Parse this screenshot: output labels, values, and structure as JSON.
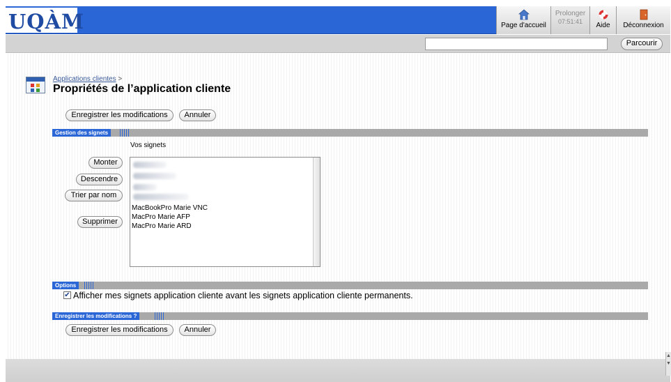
{
  "header": {
    "logo": "UQÀM",
    "home_label": "Page d'accueil",
    "prolonger_label": "Prolonger",
    "timer": "07:51:41",
    "help_label": "Aide",
    "logout_label": "Déconnexion",
    "icons": {
      "home": "home-icon",
      "help": "lifebuoy-icon",
      "logout": "door-icon"
    }
  },
  "searchbar": {
    "input_value": "",
    "browse_label": "Parcourir"
  },
  "page": {
    "breadcrumb": "Applications clientes",
    "breadcrumb_sep": ">",
    "title": "Propriétés de l’application cliente",
    "save_label": "Enregistrer les modifications",
    "cancel_label": "Annuler"
  },
  "bookmarks_section": {
    "title": "Gestion des signets",
    "list_label": "Vos signets",
    "up_label": "Monter",
    "down_label": "Descendre",
    "sort_label": "Trier par nom",
    "delete_label": "Supprimer",
    "items": [
      "MacBookPro Marie VNC",
      "MacPro Marie AFP",
      "MacPro Marie ARD"
    ]
  },
  "options_section": {
    "title": "Options",
    "checkbox_checked": true,
    "checkbox_label": "Afficher mes signets application cliente avant les signets application cliente permanents."
  },
  "save_section": {
    "title": "Enregistrer les modifications ?",
    "save_label": "Enregistrer les modifications",
    "cancel_label": "Annuler"
  },
  "colors": {
    "header_blue": "#2a66d6",
    "section_gray": "#a9a9a9",
    "toolbar_gray": "#d3d3d3"
  }
}
